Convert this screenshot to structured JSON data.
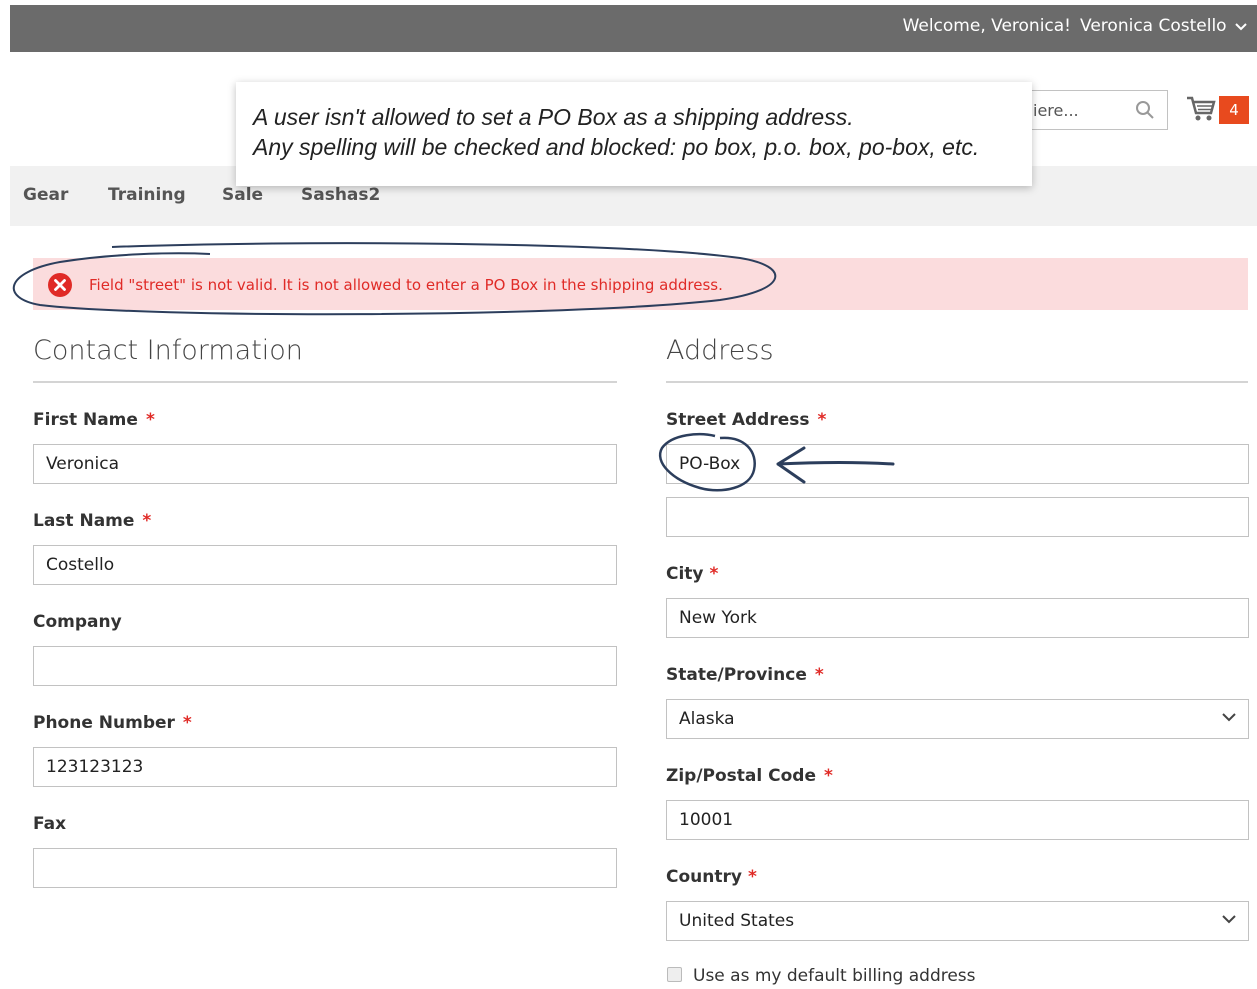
{
  "header": {
    "welcome": "Welcome, Veronica!",
    "user_menu": "Veronica Costello"
  },
  "search": {
    "placeholder": "iere..."
  },
  "cart": {
    "count": "4"
  },
  "nav": {
    "items": [
      "Gear",
      "Training",
      "Sale",
      "Sashas2"
    ]
  },
  "callout": {
    "line1": "A user isn't allowed to set a PO Box as a shipping address.",
    "line2": "Any spelling will be checked and blocked: po box, p.o. box, po-box, etc."
  },
  "error": {
    "message": "Field \"street\" is not valid. It is not allowed to enter a PO Box in the shipping address."
  },
  "contact": {
    "title": "Contact Information",
    "first_name_label": "First Name",
    "first_name_value": "Veronica",
    "last_name_label": "Last Name",
    "last_name_value": "Costello",
    "company_label": "Company",
    "company_value": "",
    "phone_label": "Phone Number",
    "phone_value": "123123123",
    "fax_label": "Fax",
    "fax_value": ""
  },
  "address": {
    "title": "Address",
    "street_label": "Street Address",
    "street_line1": "PO-Box",
    "street_line2": "",
    "city_label": "City",
    "city_value": "New York",
    "state_label": "State/Province",
    "state_value": "Alaska",
    "zip_label": "Zip/Postal Code",
    "zip_value": "10001",
    "country_label": "Country",
    "country_value": "United States",
    "default_billing_label": "Use as my default billing address",
    "default_billing_checked": false
  },
  "required_marker": "*",
  "colors": {
    "topbar": "#6b6b6b",
    "error_bg": "#fbdcdd",
    "error_text": "#e02b27",
    "cart_badge": "#e84a1e",
    "annotation_ink": "#2c3e5c"
  }
}
